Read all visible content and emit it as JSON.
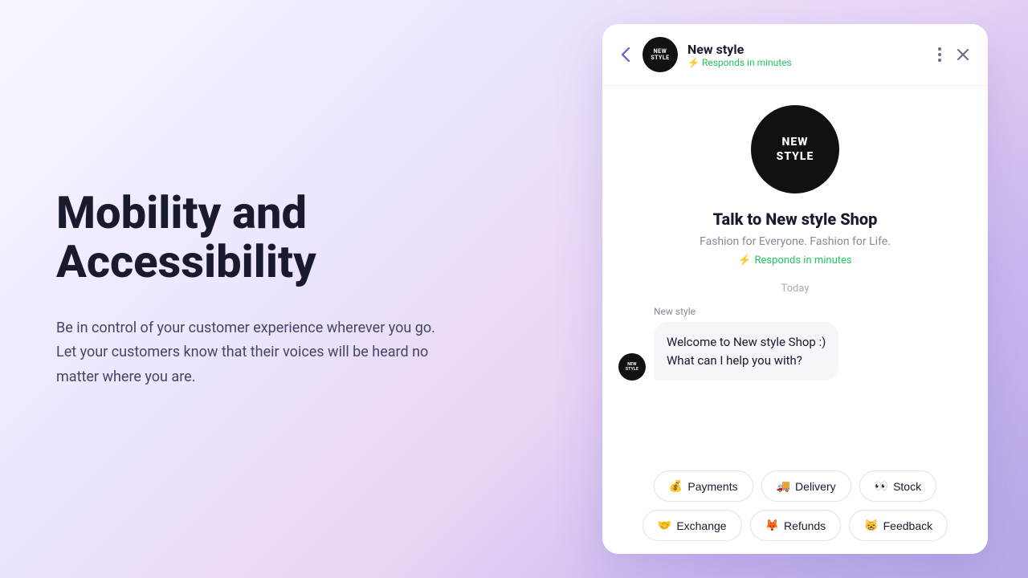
{
  "background": {
    "gradient": "linear-gradient(135deg, #f8f6ff 0%, #ede8ff 30%, #e8d5f5 60%, #c9b8f0 80%, #b8a8e8 100%)"
  },
  "left": {
    "heading_line1": "Mobility and",
    "heading_line2": "Accessibility",
    "description": "Be in control of your customer experience wherever you go. Let your customers know that their voices will be heard no matter where you are."
  },
  "chat": {
    "header": {
      "back_label": "‹",
      "shop_name": "New style",
      "status": "⚡ Responds in minutes",
      "avatar_line1": "NEW",
      "avatar_line2": "STYLE",
      "menu_icon": "⋮",
      "close_icon": "✕"
    },
    "body": {
      "logo_line1": "NEW",
      "logo_line2": "STYLE",
      "title": "Talk to New style Shop",
      "tagline": "Fashion for Everyone. Fashion for Life.",
      "responds": "⚡ Responds in minutes",
      "today": "Today",
      "message_sender": "New style",
      "message_text": "Welcome to New style Shop :)\nWhat can I help you with?"
    },
    "quick_replies": {
      "row1": [
        {
          "icon": "💰",
          "label": "Payments"
        },
        {
          "icon": "🚚",
          "label": "Delivery"
        },
        {
          "icon": "👀",
          "label": "Stock"
        }
      ],
      "row2": [
        {
          "icon": "🤝",
          "label": "Exchange"
        },
        {
          "icon": "🦊",
          "label": "Refunds"
        },
        {
          "icon": "😸",
          "label": "Feedback"
        }
      ]
    }
  }
}
